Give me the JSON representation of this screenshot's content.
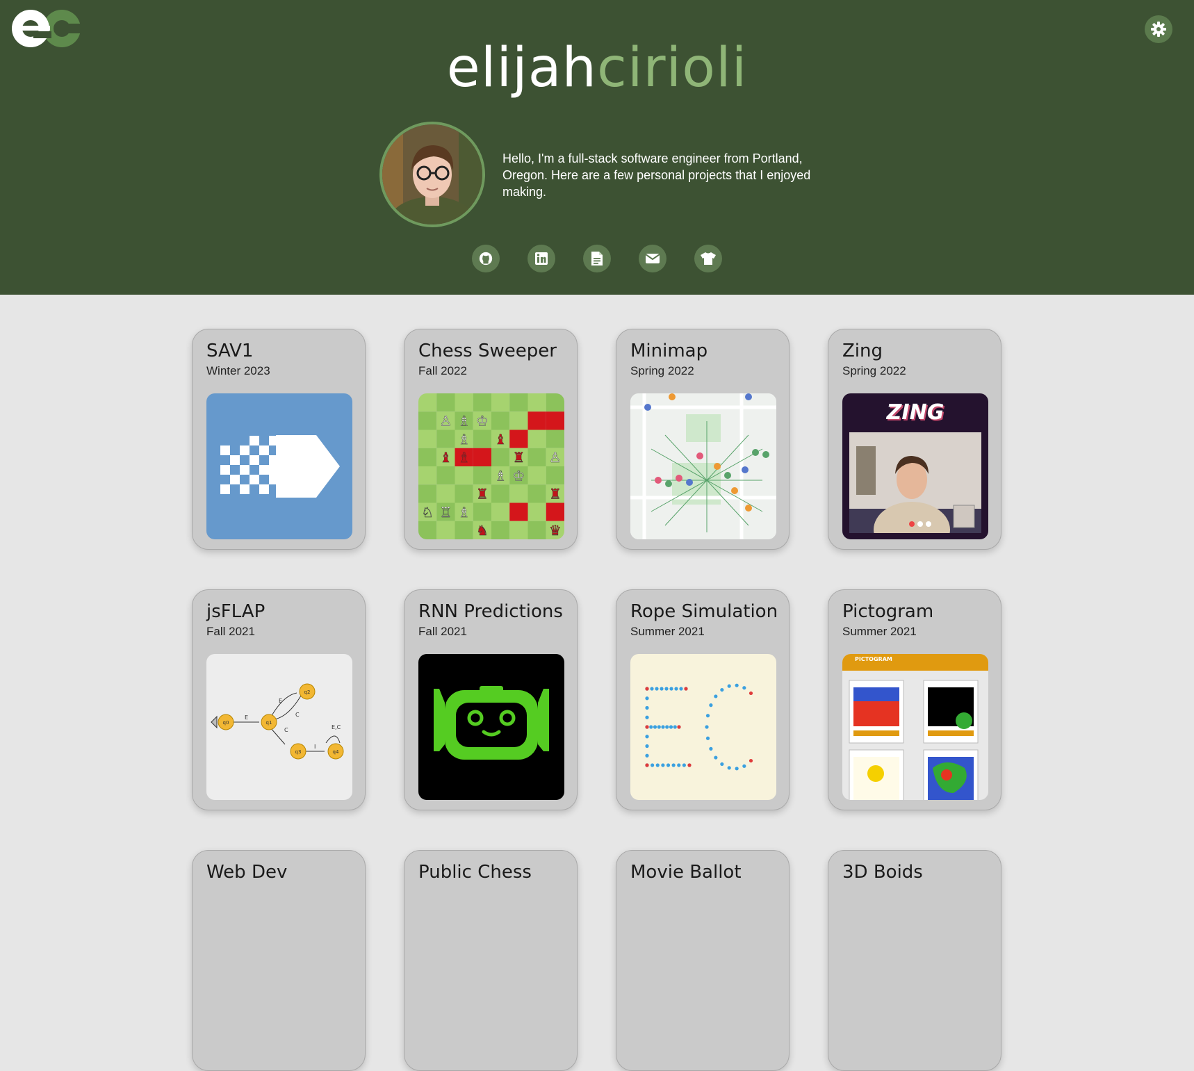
{
  "brand": {
    "logo_text": "ec",
    "first_name": "elijah",
    "last_name": "cirioli"
  },
  "intro": "Hello, I'm a full-stack software engineer from Portland, Oregon. Here are a few personal projects that I enjoyed making.",
  "socials": [
    "github-icon",
    "linkedin-icon",
    "resume-document-icon",
    "email-icon",
    "tshirt-icon"
  ],
  "colors": {
    "header_bg": "#3d5233",
    "accent_green": "#8fb577",
    "page_bg": "#e6e6e6",
    "card_bg": "#cacaca"
  },
  "projects": [
    {
      "title": "SAV1",
      "date": "Winter 2023"
    },
    {
      "title": "Chess Sweeper",
      "date": "Fall 2022"
    },
    {
      "title": "Minimap",
      "date": "Spring 2022"
    },
    {
      "title": "Zing",
      "date": "Spring 2022",
      "thumb_text": "ZING"
    },
    {
      "title": "jsFLAP",
      "date": "Fall 2021"
    },
    {
      "title": "RNN Predictions",
      "date": "Fall 2021"
    },
    {
      "title": "Rope Simulation",
      "date": "Summer 2021"
    },
    {
      "title": "Pictogram",
      "date": "Summer 2021",
      "thumb_text": "PICTOGRAM"
    },
    {
      "title": "Web Dev",
      "date": ""
    },
    {
      "title": "Public Chess",
      "date": ""
    },
    {
      "title": "Movie Ballot",
      "date": ""
    },
    {
      "title": "3D Boids",
      "date": ""
    }
  ]
}
